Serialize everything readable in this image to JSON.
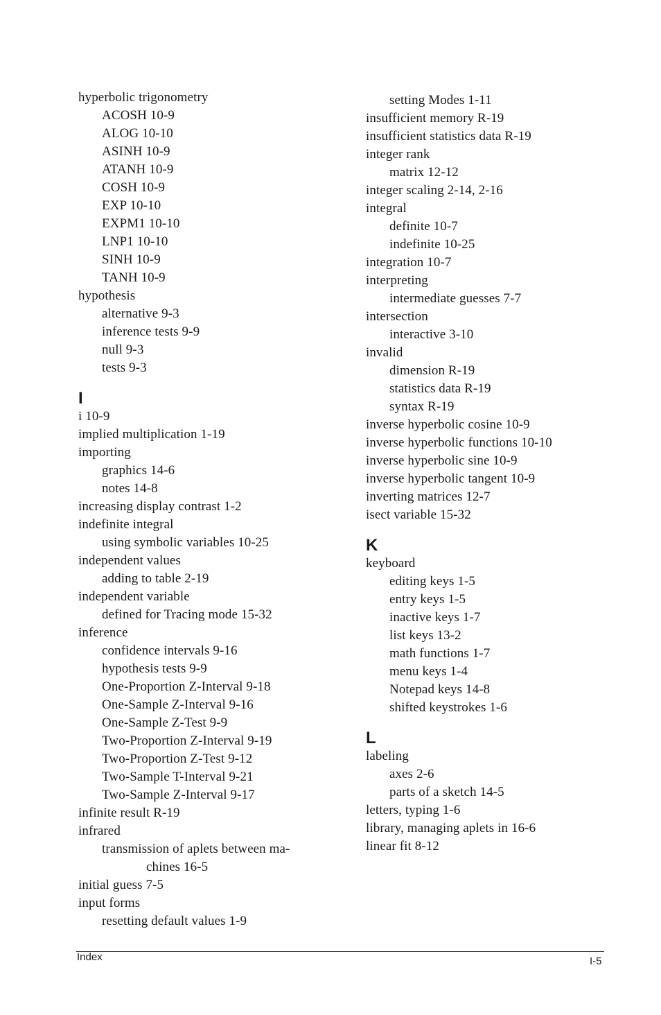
{
  "columns": [
    {
      "items": [
        {
          "type": "entry",
          "level": 1,
          "text": "hyperbolic trigonometry"
        },
        {
          "type": "entry",
          "level": 2,
          "text": "ACOSH 10-9"
        },
        {
          "type": "entry",
          "level": 2,
          "text": "ALOG 10-10"
        },
        {
          "type": "entry",
          "level": 2,
          "text": "ASINH 10-9"
        },
        {
          "type": "entry",
          "level": 2,
          "text": "ATANH 10-9"
        },
        {
          "type": "entry",
          "level": 2,
          "text": "COSH 10-9"
        },
        {
          "type": "entry",
          "level": 2,
          "text": "EXP 10-10"
        },
        {
          "type": "entry",
          "level": 2,
          "text": "EXPM1 10-10"
        },
        {
          "type": "entry",
          "level": 2,
          "text": "LNP1 10-10"
        },
        {
          "type": "entry",
          "level": 2,
          "text": "SINH 10-9"
        },
        {
          "type": "entry",
          "level": 2,
          "text": "TANH 10-9"
        },
        {
          "type": "entry",
          "level": 1,
          "text": "hypothesis"
        },
        {
          "type": "entry",
          "level": 2,
          "text": "alternative 9-3"
        },
        {
          "type": "entry",
          "level": 2,
          "text": "inference tests 9-9"
        },
        {
          "type": "entry",
          "level": 2,
          "text": "null 9-3"
        },
        {
          "type": "entry",
          "level": 2,
          "text": "tests 9-3"
        },
        {
          "type": "letter",
          "text": "I"
        },
        {
          "type": "entry",
          "level": 1,
          "text": "i 10-9"
        },
        {
          "type": "entry",
          "level": 1,
          "text": "implied multiplication 1-19"
        },
        {
          "type": "entry",
          "level": 1,
          "text": "importing"
        },
        {
          "type": "entry",
          "level": 2,
          "text": "graphics 14-6"
        },
        {
          "type": "entry",
          "level": 2,
          "text": "notes 14-8"
        },
        {
          "type": "entry",
          "level": 1,
          "text": "increasing display contrast 1-2"
        },
        {
          "type": "entry",
          "level": 1,
          "text": "indefinite integral"
        },
        {
          "type": "entry",
          "level": 2,
          "text": "using symbolic variables 10-25"
        },
        {
          "type": "entry",
          "level": 1,
          "text": "independent values"
        },
        {
          "type": "entry",
          "level": 2,
          "text": "adding to table 2-19"
        },
        {
          "type": "entry",
          "level": 1,
          "text": "independent variable"
        },
        {
          "type": "entry",
          "level": 2,
          "text": "defined for Tracing mode 15-32"
        },
        {
          "type": "entry",
          "level": 1,
          "text": "inference"
        },
        {
          "type": "entry",
          "level": 2,
          "text": "confidence intervals 9-16"
        },
        {
          "type": "entry",
          "level": 2,
          "text": "hypothesis tests 9-9"
        },
        {
          "type": "entry",
          "level": 2,
          "text": "One-Proportion Z-Interval 9-18"
        },
        {
          "type": "entry",
          "level": 2,
          "text": "One-Sample Z-Interval 9-16"
        },
        {
          "type": "entry",
          "level": 2,
          "text": "One-Sample Z-Test 9-9"
        },
        {
          "type": "entry",
          "level": 2,
          "text": "Two-Proportion Z-Interval 9-19"
        },
        {
          "type": "entry",
          "level": 2,
          "text": "Two-Proportion Z-Test 9-12"
        },
        {
          "type": "entry",
          "level": 2,
          "text": "Two-Sample T-Interval 9-21"
        },
        {
          "type": "entry",
          "level": 2,
          "text": "Two-Sample Z-Interval 9-17"
        },
        {
          "type": "entry",
          "level": 1,
          "text": "infinite result R-19"
        },
        {
          "type": "entry",
          "level": 1,
          "text": "infrared"
        },
        {
          "type": "entry",
          "level": 2,
          "text": "transmission of aplets between ma-"
        },
        {
          "type": "entry",
          "level": 3,
          "text": "chines 16-5"
        },
        {
          "type": "entry",
          "level": 1,
          "text": "initial guess 7-5"
        },
        {
          "type": "entry",
          "level": 1,
          "text": "input forms"
        },
        {
          "type": "entry",
          "level": 2,
          "text": "resetting default values 1-9"
        }
      ]
    },
    {
      "items": [
        {
          "type": "entry",
          "level": 2,
          "text": "setting Modes 1-11"
        },
        {
          "type": "entry",
          "level": 1,
          "text": "insufficient memory R-19"
        },
        {
          "type": "entry",
          "level": 1,
          "text": "insufficient statistics data R-19"
        },
        {
          "type": "entry",
          "level": 1,
          "text": "integer rank"
        },
        {
          "type": "entry",
          "level": 2,
          "text": "matrix 12-12"
        },
        {
          "type": "entry",
          "level": 1,
          "text": "integer scaling 2-14, 2-16"
        },
        {
          "type": "entry",
          "level": 1,
          "text": "integral"
        },
        {
          "type": "entry",
          "level": 2,
          "text": "definite 10-7"
        },
        {
          "type": "entry",
          "level": 2,
          "text": "indefinite 10-25"
        },
        {
          "type": "entry",
          "level": 1,
          "text": "integration 10-7"
        },
        {
          "type": "entry",
          "level": 1,
          "text": "interpreting"
        },
        {
          "type": "entry",
          "level": 2,
          "text": "intermediate guesses 7-7"
        },
        {
          "type": "entry",
          "level": 1,
          "text": "intersection"
        },
        {
          "type": "entry",
          "level": 2,
          "text": "interactive 3-10"
        },
        {
          "type": "entry",
          "level": 1,
          "text": "invalid"
        },
        {
          "type": "entry",
          "level": 2,
          "text": "dimension R-19"
        },
        {
          "type": "entry",
          "level": 2,
          "text": "statistics data R-19"
        },
        {
          "type": "entry",
          "level": 2,
          "text": "syntax R-19"
        },
        {
          "type": "entry",
          "level": 1,
          "text": "inverse hyperbolic cosine 10-9"
        },
        {
          "type": "entry",
          "level": 1,
          "text": "inverse hyperbolic functions 10-10"
        },
        {
          "type": "entry",
          "level": 1,
          "text": "inverse hyperbolic sine 10-9"
        },
        {
          "type": "entry",
          "level": 1,
          "text": "inverse hyperbolic tangent 10-9"
        },
        {
          "type": "entry",
          "level": 1,
          "text": "inverting matrices 12-7"
        },
        {
          "type": "entry",
          "level": 1,
          "text": "isect variable 15-32"
        },
        {
          "type": "letter",
          "text": "K"
        },
        {
          "type": "entry",
          "level": 1,
          "text": "keyboard"
        },
        {
          "type": "entry",
          "level": 2,
          "text": "editing keys 1-5"
        },
        {
          "type": "entry",
          "level": 2,
          "text": "entry keys 1-5"
        },
        {
          "type": "entry",
          "level": 2,
          "text": "inactive keys 1-7"
        },
        {
          "type": "entry",
          "level": 2,
          "text": "list keys 13-2"
        },
        {
          "type": "entry",
          "level": 2,
          "text": "math functions 1-7"
        },
        {
          "type": "entry",
          "level": 2,
          "text": "menu keys 1-4"
        },
        {
          "type": "entry",
          "level": 2,
          "text": "Notepad keys 14-8"
        },
        {
          "type": "entry",
          "level": 2,
          "text": "shifted keystrokes 1-6"
        },
        {
          "type": "letter",
          "text": "L"
        },
        {
          "type": "entry",
          "level": 1,
          "text": "labeling"
        },
        {
          "type": "entry",
          "level": 2,
          "text": "axes 2-6"
        },
        {
          "type": "entry",
          "level": 2,
          "text": "parts of a sketch 14-5"
        },
        {
          "type": "entry",
          "level": 1,
          "text": "letters, typing 1-6"
        },
        {
          "type": "entry",
          "level": 1,
          "text": "library, managing aplets in 16-6"
        },
        {
          "type": "entry",
          "level": 1,
          "text": "linear fit 8-12"
        }
      ]
    }
  ],
  "footer": {
    "section_label": "Index",
    "page_number": "I-5"
  }
}
